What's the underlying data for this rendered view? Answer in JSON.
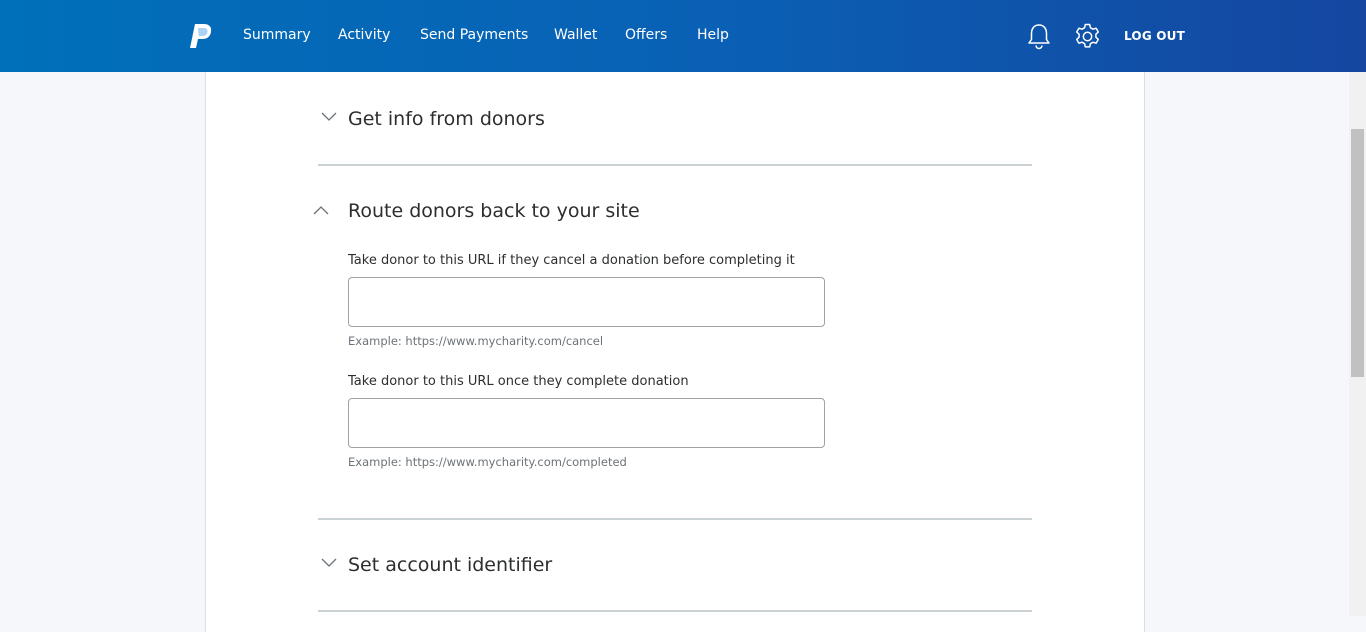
{
  "nav": {
    "items": [
      {
        "label": "Summary"
      },
      {
        "label": "Activity"
      },
      {
        "label": "Send Payments"
      },
      {
        "label": "Wallet"
      },
      {
        "label": "Offers"
      },
      {
        "label": "Help"
      }
    ],
    "logout_label": "LOG OUT",
    "icons": [
      "paypal-logo",
      "bell-icon",
      "gear-icon"
    ]
  },
  "sections": [
    {
      "title": "Get info from donors",
      "state": "collapsed"
    },
    {
      "title": "Route donors back to your site",
      "state": "expanded"
    },
    {
      "title": "Set account identifier",
      "state": "collapsed"
    }
  ],
  "route": {
    "cancel": {
      "label": "Take donor to this URL if they cancel a donation before completing it",
      "value": "",
      "example": "Example: https://www.mycharity.com/cancel"
    },
    "complete": {
      "label": "Take donor to this URL once they complete donation",
      "value": "",
      "example": "Example: https://www.mycharity.com/completed"
    }
  },
  "colors": {
    "header_start": "#0070ba",
    "header_end": "#1546a0",
    "divider": "#cbd2d6"
  }
}
